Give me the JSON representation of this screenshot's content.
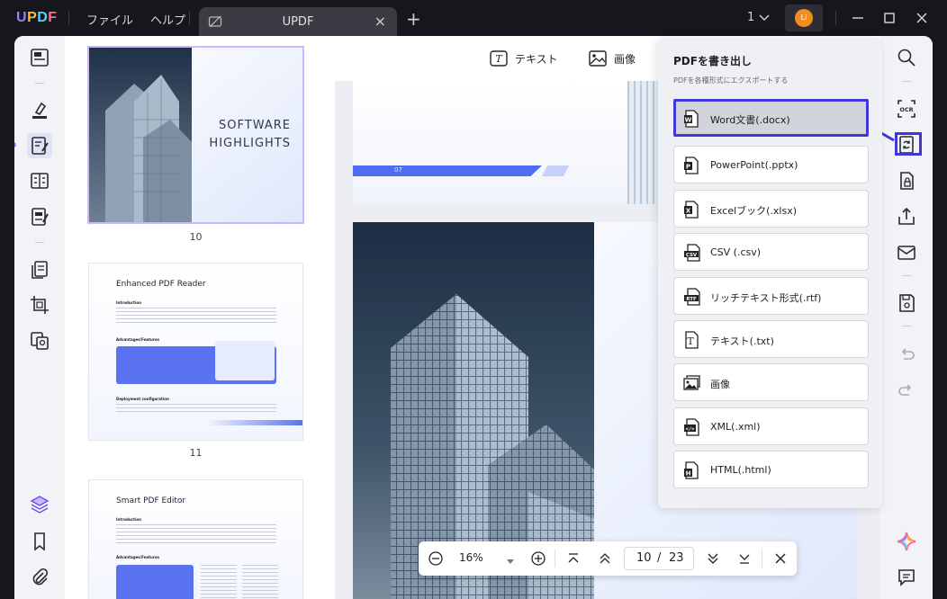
{
  "app": {
    "logo": {
      "u": "U",
      "p": "P",
      "d": "D",
      "f": "F"
    },
    "menu": [
      "ファイル",
      "ヘルプ"
    ],
    "tab_title": "UPDF",
    "tab_count": "1",
    "avatar_initials": "Li"
  },
  "doc_toolbar": {
    "text_label": "テキスト",
    "image_label": "画像"
  },
  "thumbnails": [
    {
      "number": "10",
      "title_line1": "SOFTWARE",
      "title_line2": "HIGHLIGHTS"
    },
    {
      "number": "11",
      "title": "Enhanced PDF Reader",
      "sub": "Introduction",
      "sub2": "Advantages/Features",
      "sub3": "Deployment configuration"
    },
    {
      "title": "Smart PDF Editor",
      "sub": "Introduction",
      "sub2": "Advantages/Features"
    }
  ],
  "page_partial": {
    "label": "07"
  },
  "zoom": {
    "value": "16%",
    "current_page": "10",
    "separator": "/",
    "total_pages": "23"
  },
  "export_panel": {
    "title": "PDFを書き出し",
    "subtitle": "PDFを各種形式にエクスポートする",
    "items": [
      {
        "label": "Word文書(.docx)",
        "icon": "word-icon",
        "badge": "W"
      },
      {
        "label": "PowerPoint(.pptx)",
        "icon": "powerpoint-icon",
        "badge": "P"
      },
      {
        "label": "Excelブック(.xlsx)",
        "icon": "excel-icon",
        "badge": "X"
      },
      {
        "label": "CSV (.csv)",
        "icon": "csv-icon",
        "badge": "CSV"
      },
      {
        "label": "リッチテキスト形式(.rtf)",
        "icon": "rtf-icon",
        "badge": "RTF"
      },
      {
        "label": "テキスト(.txt)",
        "icon": "txt-icon",
        "badge": "T"
      },
      {
        "label": "画像",
        "icon": "image-icon",
        "badge": ""
      },
      {
        "label": "XML(.xml)",
        "icon": "xml-icon",
        "badge": "</>"
      },
      {
        "label": "HTML(.html)",
        "icon": "html-icon",
        "badge": "H"
      }
    ]
  },
  "colors": {
    "accent": "#3f37d6",
    "title_bg": "#16171d",
    "avatar": "#f28c1f"
  }
}
